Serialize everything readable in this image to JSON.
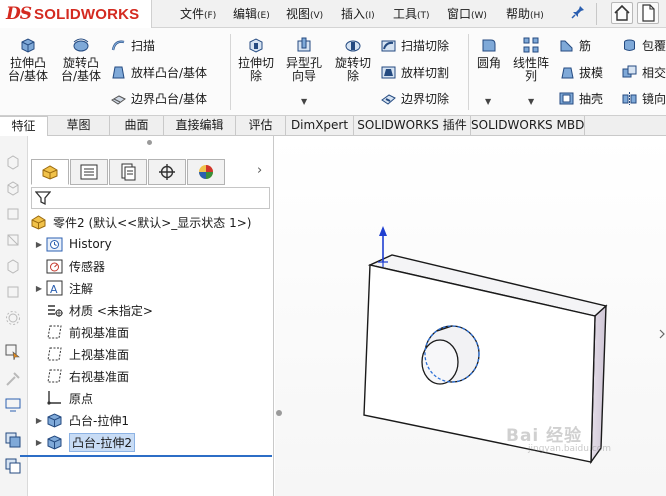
{
  "app": {
    "logo_ds": "DS",
    "logo_name": "SOLIDWORKS"
  },
  "menu": [
    {
      "label": "文件",
      "accel": "(F)"
    },
    {
      "label": "编辑",
      "accel": "(E)"
    },
    {
      "label": "视图",
      "accel": "(V)"
    },
    {
      "label": "插入",
      "accel": "(I)"
    },
    {
      "label": "工具",
      "accel": "(T)"
    },
    {
      "label": "窗口",
      "accel": "(W)"
    },
    {
      "label": "帮助",
      "accel": "(H)"
    }
  ],
  "ribbon": {
    "extrude_boss": "拉伸凸\n台/基体",
    "revolve_boss": "旋转凸\n台/基体",
    "sweep": "扫描",
    "loft_boss": "放样凸台/基体",
    "boundary_boss": "边界凸台/基体",
    "extrude_cut": "拉伸切\n除",
    "hole_wizard": "异型孔\n向导",
    "revolve_cut": "旋转切\n除",
    "swept_cut": "扫描切除",
    "lofted_cut": "放样切割",
    "boundary_cut": "边界切除",
    "fillet": "圆角",
    "linear_pattern": "线性阵\n列",
    "rib": "筋",
    "draft": "拔模",
    "shell": "抽壳",
    "wrap": "包覆",
    "intersect": "相交",
    "mirror": "镜向"
  },
  "tabs": [
    {
      "label": "特征",
      "active": true
    },
    {
      "label": "草图",
      "active": false
    },
    {
      "label": "曲面",
      "active": false
    },
    {
      "label": "直接编辑",
      "active": false
    },
    {
      "label": "评估",
      "active": false
    },
    {
      "label": "DimXpert",
      "active": false
    },
    {
      "label": "SOLIDWORKS 插件",
      "active": false
    },
    {
      "label": "SOLIDWORKS MBD",
      "active": false
    }
  ],
  "tree": {
    "root": "零件2  (默认<<默认>_显示状态 1>)",
    "items": [
      {
        "label": "History",
        "expandable": true
      },
      {
        "label": "传感器",
        "expandable": false
      },
      {
        "label": "注解",
        "expandable": true
      },
      {
        "label": "材质 <未指定>",
        "expandable": false
      },
      {
        "label": "前视基准面",
        "expandable": false
      },
      {
        "label": "上视基准面",
        "expandable": false
      },
      {
        "label": "右视基准面",
        "expandable": false
      },
      {
        "label": "原点",
        "expandable": false
      },
      {
        "label": "凸台-拉伸1",
        "expandable": true
      },
      {
        "label": "凸台-拉伸2",
        "expandable": true,
        "selected": true
      }
    ]
  },
  "colors": {
    "brand_red": "#d42a20",
    "selection_blue": "#2c6dc6",
    "axis_blue": "#1f3fd1"
  },
  "watermark": {
    "main": "Bai 经验",
    "sub": "jingyan.baidu.com"
  }
}
